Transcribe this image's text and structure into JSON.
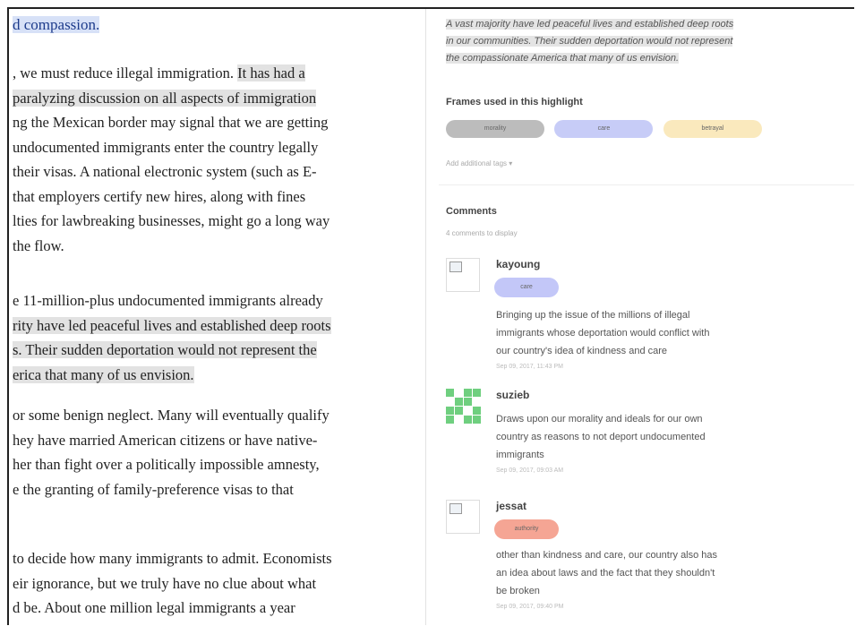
{
  "article": {
    "heading": "d compassion.",
    "paragraphs": [
      {
        "lines": [
          {
            "plain": ", we must reduce illegal immigration. ",
            "highlight": "It has had a"
          },
          {
            "plain": "",
            "highlight": "paralyzing discussion on all aspects of immigration"
          },
          {
            "plain": "ng the Mexican border may signal that we are getting",
            "highlight": ""
          },
          {
            "plain": "undocumented immigrants enter the country legally",
            "highlight": ""
          },
          {
            "plain": "their visas. A national electronic system (such as E-",
            "highlight": ""
          },
          {
            "plain": " that employers certify new hires, along with fines",
            "highlight": ""
          },
          {
            "plain": "lties for lawbreaking businesses, might go a long way",
            "highlight": ""
          },
          {
            "plain": "the flow.",
            "highlight": ""
          }
        ]
      },
      {
        "lines": [
          {
            "plain": "e 11-million-plus undocumented immigrants already",
            "highlight": ""
          },
          {
            "plain": "",
            "highlight": "rity have led peaceful lives and established deep roots"
          },
          {
            "plain": "",
            "highlight": "s. Their sudden deportation would not represent the"
          },
          {
            "plain": "",
            "highlight": "erica that many of us envision."
          }
        ]
      },
      {
        "lines": [
          {
            "plain": "or some benign neglect. Many will eventually qualify",
            "highlight": ""
          },
          {
            "plain": "hey have married American citizens or have native-",
            "highlight": ""
          },
          {
            "plain": "her than fight over a politically impossible amnesty,",
            "highlight": ""
          },
          {
            "plain": "e the granting of family-preference visas to that",
            "highlight": ""
          }
        ]
      },
      {
        "lines": [
          {
            "plain": "to decide how many immigrants to admit. Economists",
            "highlight": ""
          },
          {
            "plain": "eir ignorance, but we truly have no clue about what",
            "highlight": ""
          },
          {
            "plain": "d be. About one million legal immigrants a year",
            "highlight": ""
          }
        ]
      }
    ]
  },
  "panel": {
    "quote_lines": [
      "A vast majority have led peaceful lives and established deep roots",
      "in our communities. Their sudden deportation would not represent",
      "the compassionate America that many of us envision."
    ],
    "frames_title": "Frames used in this highlight",
    "frames": [
      {
        "label": "morality",
        "color": "#bcbcbc"
      },
      {
        "label": "care",
        "color": "#c7ccf7"
      },
      {
        "label": "betrayal",
        "color": "#fae9bd"
      }
    ],
    "add_tags": "Add additional tags ▾",
    "comments_title": "Comments",
    "comments_count": "4 comments to display",
    "comments": [
      {
        "user": "kayoung",
        "avatar": "broken-image-icon",
        "badge": "care",
        "badge_color": "#c3c7f8",
        "text_lines": [
          "Bringing up the issue of the millions of illegal",
          "immigrants whose deportation would conflict with",
          "our country's idea of kindness and care"
        ],
        "time": "Sep 09, 2017, 11:43 PM"
      },
      {
        "user": "suzieb",
        "avatar": "identicon",
        "badge": "",
        "text_lines": [
          "Draws upon our morality and ideals for our own",
          "country as reasons to not deport undocumented",
          "immigrants"
        ],
        "time": "Sep 09, 2017, 09:03 AM"
      },
      {
        "user": "jessat",
        "avatar": "broken-image-icon",
        "badge": "authority",
        "badge_color": "#f5a594",
        "text_lines": [
          "other than kindness and care, our country also has",
          "an idea about laws and the fact that they shouldn't",
          "be broken"
        ],
        "time": "Sep 09, 2017, 09:40 PM"
      }
    ]
  }
}
